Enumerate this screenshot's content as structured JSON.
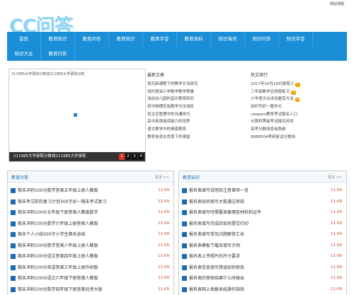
{
  "topbar": {
    "sitemap": "网站地图"
  },
  "logo": "CC问答",
  "nav": {
    "row1": [
      "首页",
      "教育知识",
      "教育问答",
      "教育知识",
      "教育学堂",
      "教育资料",
      "知识海洋",
      "知识问答",
      "知识学堂"
    ],
    "row2": [
      "知识大全",
      "教育问答"
    ]
  },
  "slider": {
    "caption_top": "211985大学录取分数线211985大学录取分数",
    "caption_bottom": "211985大学录取分数线211985大学录取",
    "nums": [
      "1",
      "2",
      "3",
      "4"
    ]
  },
  "latest": {
    "heading": "最新文章",
    "items": [
      "探究新课程下的教学方法研究",
      "如何提高小学数学教学质量",
      "浅谈幼儿园的音乐教育研究",
      "初中物理实验教学方法浅析",
      "班主任管理中的沟通技巧",
      "高中英语阅读能力的培养",
      "语文教学中的情感教育",
      "教育信息化背景下的课堂"
    ]
  },
  "hot": {
    "heading": "热文排行",
    "items": [
      {
        "text": "2017年10月18日是周几",
        "badge": "1"
      },
      {
        "text": "三年级数学应用题练习",
        "badge": "2"
      },
      {
        "text": "小学语文古诗词鉴赏方法",
        "badge": "3"
      },
      {
        "text": "如何写好一篇作文",
        "badge": ""
      },
      {
        "text": "caopom教育考试报名入口",
        "badge": ""
      },
      {
        "text": "计算机等级考试报名时间",
        "badge": ""
      },
      {
        "text": "高考分数线查询系统",
        "badge": ""
      },
      {
        "text": "8888504考研复试分数线",
        "badge": ""
      }
    ]
  },
  "panel_left": {
    "title": "教育问答",
    "more": "更多 >>",
    "items": [
      {
        "text": "期末冲刺100分数学答案五年级上册人教版",
        "date": "11-09"
      },
      {
        "text": "期末考试前的复习计划300字初一期末考试复习",
        "date": "11-09"
      },
      {
        "text": "期末冲刺100分五年级下册答案人教版数学",
        "date": "11-09"
      },
      {
        "text": "期末冲刺100分数学六年级上册答案人教版",
        "date": "11-09"
      },
      {
        "text": "期末个人小结300字小学生期末总结",
        "date": "11-09"
      },
      {
        "text": "期末冲刺100分数学答案八年级上册人教版",
        "date": "11-09"
      },
      {
        "text": "期末冲刺100分语文答案四年级上册人教版",
        "date": "11-09"
      },
      {
        "text": "期末冲刺100分英语答案三年级上册外研版",
        "date": "11-09"
      },
      {
        "text": "期末冲刺100分语文六年级下册答案人教版",
        "date": "11-09"
      },
      {
        "text": "期末冲刺100分数学四年级下册答案北师大版",
        "date": "11-09"
      }
    ]
  },
  "panel_right": {
    "title": "教育知识",
    "more": "更多 >>",
    "items": [
      {
        "text": "报名表填写说明及注意事项一览",
        "date": "11-09"
      },
      {
        "text": "报名表如何填写才能通过审核",
        "date": "11-09"
      },
      {
        "text": "报名表填写时需要准备哪些材料和证件",
        "date": "11-09"
      },
      {
        "text": "报名表填写完成后如何提交打印",
        "date": "11-09"
      },
      {
        "text": "报名表填写常见问题解答汇总",
        "date": "11-09"
      },
      {
        "text": "报名表模板下载及填写示例",
        "date": "11-09"
      },
      {
        "text": "报名表上传照片的尺寸要求",
        "date": "11-09"
      },
      {
        "text": "报名表信息填写错误如何修改",
        "date": "11-09"
      },
      {
        "text": "报名表的审核结果什么时候出",
        "date": "11-09"
      },
      {
        "text": "报名表网上填报系统操作指南",
        "date": "11-09"
      }
    ]
  }
}
